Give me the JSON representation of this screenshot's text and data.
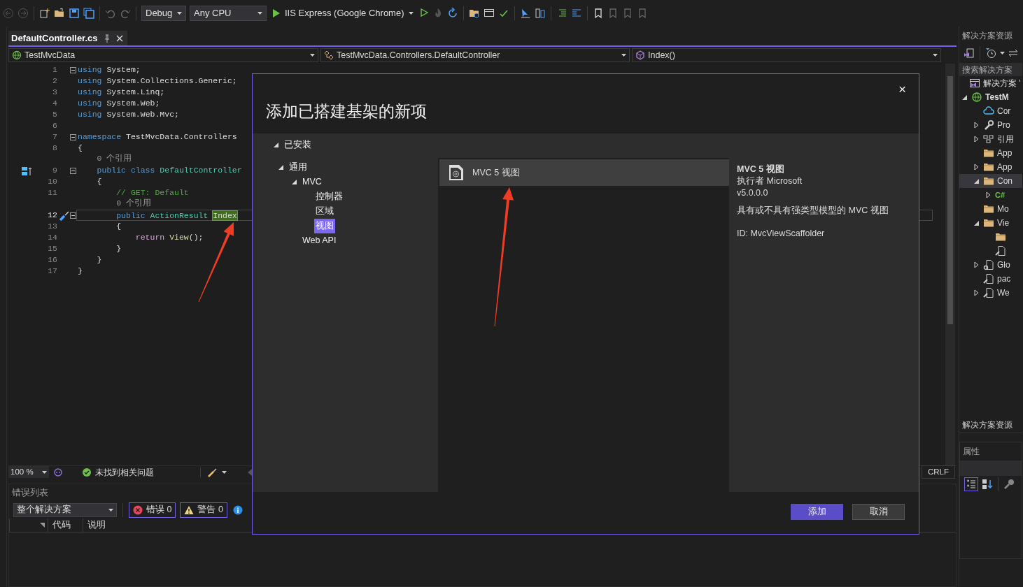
{
  "toolbar": {
    "configuration": "Debug",
    "platform": "Any CPU",
    "run_target": "IIS Express (Google Chrome)"
  },
  "editor": {
    "tabs": [
      {
        "label": "DefaultController.cs",
        "selected": true
      }
    ],
    "nav": {
      "project": "TestMvcData",
      "type": "TestMvcData.Controllers.DefaultController",
      "member": "Index()"
    },
    "lines": [
      {
        "number": "1",
        "foldable": true,
        "tokens": [
          {
            "kind": "keyword",
            "text": "using"
          },
          {
            "kind": "plain",
            "text": " System;"
          }
        ]
      },
      {
        "number": "2",
        "tokens": [
          {
            "kind": "keyword",
            "text": "using"
          },
          {
            "kind": "plain",
            "text": " System.Collections.Generic;"
          }
        ]
      },
      {
        "number": "3",
        "tokens": [
          {
            "kind": "keyword",
            "text": "using"
          },
          {
            "kind": "plain",
            "text": " System.Linq;"
          }
        ]
      },
      {
        "number": "4",
        "tokens": [
          {
            "kind": "keyword",
            "text": "using"
          },
          {
            "kind": "plain",
            "text": " System.Web;"
          }
        ]
      },
      {
        "number": "5",
        "tokens": [
          {
            "kind": "keyword",
            "text": "using"
          },
          {
            "kind": "plain",
            "text": " System.Web.Mvc;"
          }
        ]
      },
      {
        "number": "6"
      },
      {
        "number": "7",
        "foldable": true,
        "tokens": [
          {
            "kind": "keyword",
            "text": "namespace"
          },
          {
            "kind": "plain",
            "text": " TestMvcData.Controllers"
          }
        ]
      },
      {
        "number": "8",
        "tokens": [
          {
            "kind": "plain",
            "text": "{"
          }
        ]
      },
      {
        "tokens": [
          {
            "kind": "ref",
            "text": "    0 个引用"
          }
        ]
      },
      {
        "number": "9",
        "foldable": true,
        "implementation_marker": true,
        "tokens": [
          {
            "kind": "keyword",
            "text": "    public class"
          },
          {
            "kind": "type",
            "text": " DefaultController"
          }
        ]
      },
      {
        "number": "10",
        "tokens": [
          {
            "kind": "plain",
            "text": "    {"
          }
        ]
      },
      {
        "number": "11",
        "tokens": [
          {
            "kind": "comment",
            "text": "        // GET: Default"
          }
        ]
      },
      {
        "tokens": [
          {
            "kind": "ref",
            "text": "        0 个引用"
          }
        ]
      },
      {
        "number": "12",
        "foldable": true,
        "current": true,
        "quick_actions": true,
        "tokens": [
          {
            "kind": "keyword",
            "text": "        public"
          },
          {
            "kind": "type",
            "text": " ActionResult "
          },
          {
            "kind": "highlight",
            "text": "Index"
          }
        ]
      },
      {
        "number": "13",
        "tokens": [
          {
            "kind": "plain",
            "text": "        {"
          }
        ]
      },
      {
        "number": "14",
        "tokens": [
          {
            "kind": "control",
            "text": "            return"
          },
          {
            "kind": "method",
            "text": " View"
          },
          {
            "kind": "plain",
            "text": "();"
          }
        ]
      },
      {
        "number": "15",
        "tokens": [
          {
            "kind": "plain",
            "text": "        }"
          }
        ]
      },
      {
        "number": "16",
        "tokens": [
          {
            "kind": "plain",
            "text": "    }"
          }
        ]
      },
      {
        "number": "17",
        "tokens": [
          {
            "kind": "plain",
            "text": "}"
          }
        ]
      }
    ]
  },
  "status": {
    "zoom": "100 %",
    "issues": "未找到相关问题",
    "line_ending": "CRLF"
  },
  "error_list": {
    "title": "错误列表",
    "scope": "整个解决方案",
    "filters": [
      {
        "kind": "error",
        "label": "错误 0",
        "selected": true
      },
      {
        "kind": "warning",
        "label": "警告 0",
        "selected": true
      },
      {
        "kind": "info",
        "selected": false
      }
    ],
    "columns": [
      "代码",
      "说明"
    ]
  },
  "solution_explorer": {
    "title": "解决方案资源",
    "search": {
      "placeholder": "搜索解决方案"
    },
    "tree": [
      {
        "kind": "solution",
        "label": "解决方案 '",
        "selected": false,
        "children": [
          {
            "kind": "web-project",
            "label": "TestM",
            "expanded": true,
            "selected": false,
            "children": [
              {
                "kind": "connected-service",
                "label": "Cor",
                "selected": false
              },
              {
                "kind": "properties",
                "label": "Pro",
                "expanded": false,
                "selected": false
              },
              {
                "kind": "references",
                "label": "引用",
                "expanded": false,
                "selected": false
              },
              {
                "kind": "folder",
                "label": "App",
                "selected": false
              },
              {
                "kind": "folder",
                "label": "App",
                "expanded": false,
                "selected": false
              },
              {
                "kind": "folder",
                "label": "Con",
                "expanded": true,
                "selected": true,
                "children": [
                  {
                    "kind": "csharp-file",
                    "glyph": "C#",
                    "expanded": false,
                    "selected": false
                  }
                ]
              },
              {
                "kind": "folder",
                "label": "Mo",
                "selected": false
              },
              {
                "kind": "folder",
                "label": "Vie",
                "expanded": true,
                "selected": false,
                "children": [
                  {
                    "kind": "folder",
                    "selected": false
                  },
                  {
                    "kind": "config-file",
                    "selected": false
                  }
                ]
              },
              {
                "kind": "global-file",
                "label": "Glo",
                "expanded": false,
                "selected": false
              },
              {
                "kind": "config-file",
                "label": "pac",
                "selected": false
              },
              {
                "kind": "config-file",
                "label": "We",
                "expanded": false,
                "selected": false
              }
            ]
          }
        ]
      }
    ]
  },
  "bottom_tab": "解决方案资源",
  "properties": {
    "title": "属性"
  },
  "dialog": {
    "title": "添加已搭建基架的新项",
    "close": "×",
    "categories": [
      {
        "label": "已安装",
        "expanded": true,
        "selected": false,
        "children": [
          {
            "label": "通用",
            "expanded": true,
            "selected": false,
            "children": [
              {
                "label": "MVC",
                "expanded": true,
                "selected": false,
                "children": [
                  {
                    "label": "控制器",
                    "selected": false
                  },
                  {
                    "label": "区域",
                    "selected": false
                  },
                  {
                    "label": "视图",
                    "selected": true
                  }
                ]
              },
              {
                "label": "Web API",
                "selected": false
              }
            ]
          }
        ]
      }
    ],
    "templates": [
      {
        "label": "MVC 5 视图",
        "selected": true
      }
    ],
    "details": {
      "name": "MVC 5 视图",
      "author": "执行者 Microsoft",
      "version": "v5.0.0.0",
      "description": "具有或不具有强类型模型的 MVC 视图",
      "id": "ID: MvcViewScaffolder"
    },
    "buttons": [
      {
        "label": "添加",
        "kind": "primary"
      },
      {
        "label": "取消",
        "kind": "secondary"
      }
    ]
  }
}
